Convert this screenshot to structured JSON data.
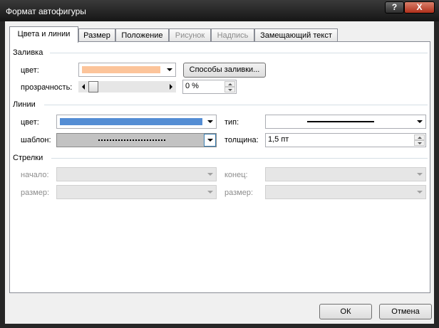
{
  "window": {
    "title": "Формат автофигуры",
    "help_icon": "?",
    "close_icon": "X"
  },
  "tabs": [
    {
      "label": "Цвета и линии",
      "state": "active"
    },
    {
      "label": "Размер",
      "state": "normal"
    },
    {
      "label": "Положение",
      "state": "normal"
    },
    {
      "label": "Рисунок",
      "state": "disabled"
    },
    {
      "label": "Надпись",
      "state": "disabled"
    },
    {
      "label": "Замещающий текст",
      "state": "normal"
    }
  ],
  "fill": {
    "group_label": "Заливка",
    "color_label": "цвет:",
    "color_value": "#fcc49a",
    "effects_button": "Способы заливки...",
    "transparency_label": "прозрачность:",
    "transparency_value": "0 %",
    "transparency_level": 0
  },
  "lines": {
    "group_label": "Линии",
    "color_label": "цвет:",
    "color_value": "#548dd4",
    "type_label": "тип:",
    "pattern_label": "шаблон:",
    "weight_label": "толщина:",
    "weight_value": "1,5 пт"
  },
  "arrows": {
    "group_label": "Стрелки",
    "begin_label": "начало:",
    "begin_size_label": "размер:",
    "end_label": "конец:",
    "end_size_label": "размер:"
  },
  "footer": {
    "ok": "ОК",
    "cancel": "Отмена"
  },
  "colors": {
    "accent": "#548dd4",
    "fill": "#fcc49a",
    "close_button": "#c44a33"
  }
}
